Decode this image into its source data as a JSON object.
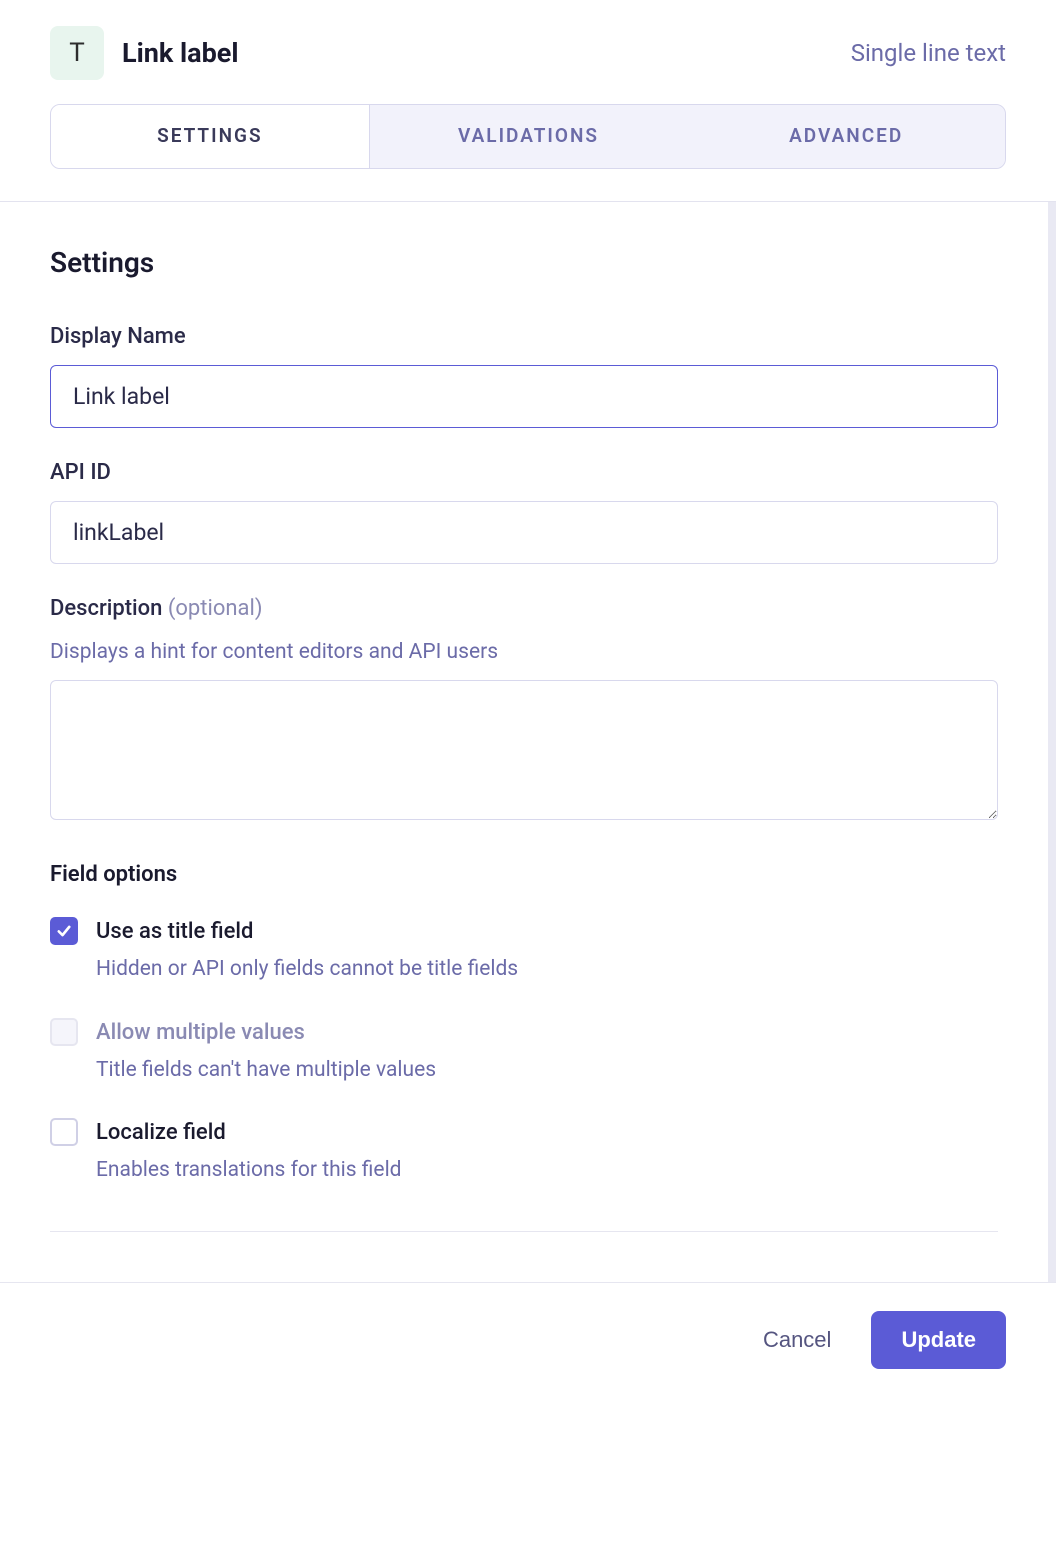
{
  "header": {
    "type_icon_letter": "T",
    "title": "Link label",
    "type_label": "Single line text"
  },
  "tabs": [
    {
      "label": "SETTINGS",
      "active": true
    },
    {
      "label": "VALIDATIONS",
      "active": false
    },
    {
      "label": "ADVANCED",
      "active": false
    }
  ],
  "settings": {
    "section_title": "Settings",
    "display_name": {
      "label": "Display Name",
      "value": "Link label"
    },
    "api_id": {
      "label": "API ID",
      "value": "linkLabel"
    },
    "description": {
      "label": "Description",
      "optional_tag": "(optional)",
      "hint": "Displays a hint for content editors and API users",
      "value": ""
    },
    "field_options_title": "Field options",
    "options": {
      "title_field": {
        "label": "Use as title field",
        "desc": "Hidden or API only fields cannot be title fields",
        "checked": true,
        "disabled": false
      },
      "allow_multiple": {
        "label": "Allow multiple values",
        "desc": "Title fields can't have multiple values",
        "checked": false,
        "disabled": true
      },
      "localize": {
        "label": "Localize field",
        "desc": "Enables translations for this field",
        "checked": false,
        "disabled": false
      }
    }
  },
  "footer": {
    "cancel_label": "Cancel",
    "update_label": "Update"
  }
}
